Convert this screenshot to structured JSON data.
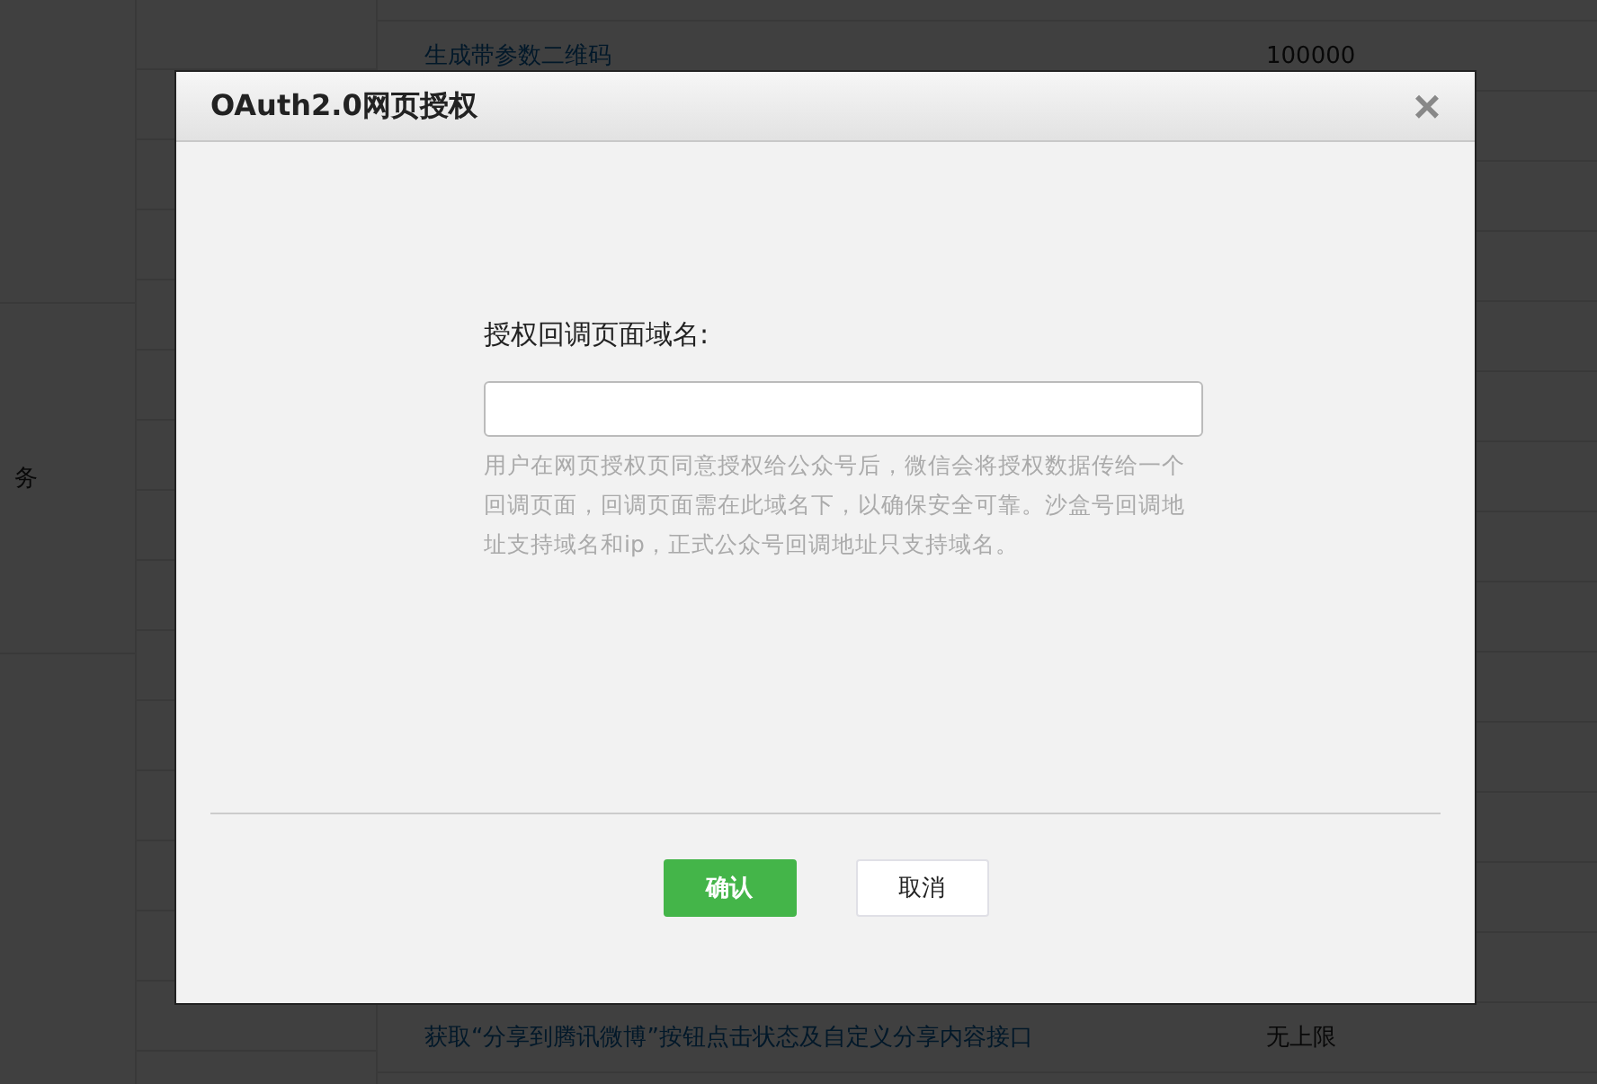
{
  "background_table": {
    "side_label": "务",
    "rows": [
      {
        "name": "生成带参数二维码",
        "value": "100000"
      },
      {
        "name": "获取“分享到腾讯微博”按钮点击状态及自定义分享内容接口",
        "value": "无上限"
      }
    ]
  },
  "dialog": {
    "title": "OAuth2.0网页授权",
    "close": "×",
    "field_label": "授权回调页面域名:",
    "help": "用户在网页授权页同意授权给公众号后，微信会将授权数据传给一个回调页面，回调页面需在此域名下，以确保安全可靠。沙盒号回调地址支持域名和ip，正式公众号回调地址只支持域名。",
    "buttons": [
      {
        "label": "确认",
        "kind": "primary"
      },
      {
        "label": "取消",
        "kind": "secondary"
      }
    ]
  }
}
